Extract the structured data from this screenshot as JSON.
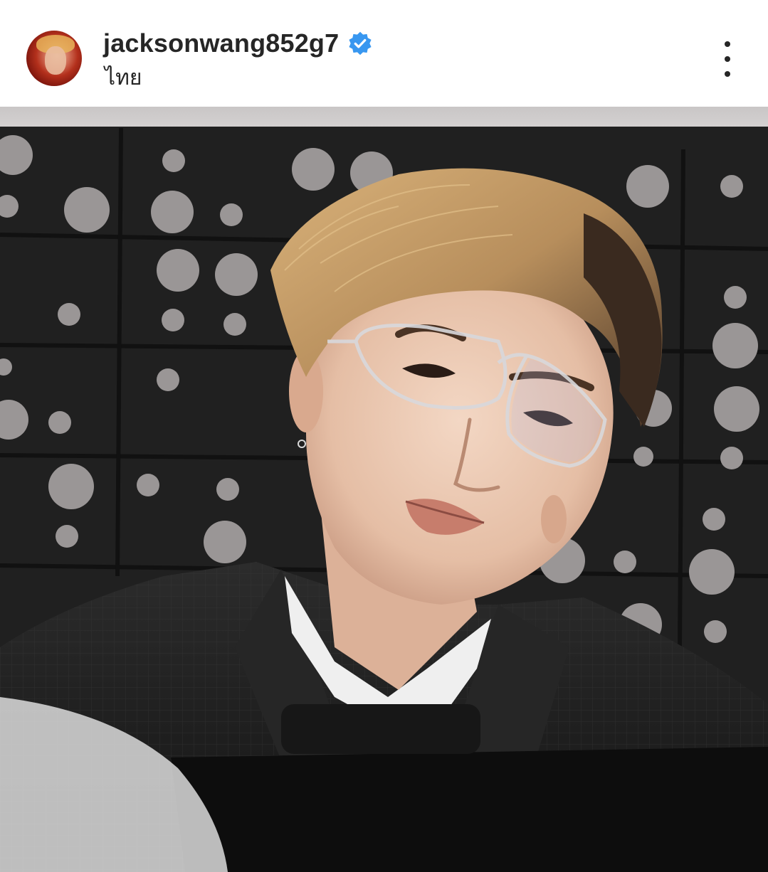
{
  "post": {
    "username": "jacksonwang852g7",
    "location": "ไทย",
    "verified": true,
    "verified_color": "#3897f0",
    "text_color": "#262626"
  },
  "icons": {
    "avatar": "profile-avatar",
    "verified": "verified-badge-icon",
    "more": "more-options-icon"
  }
}
